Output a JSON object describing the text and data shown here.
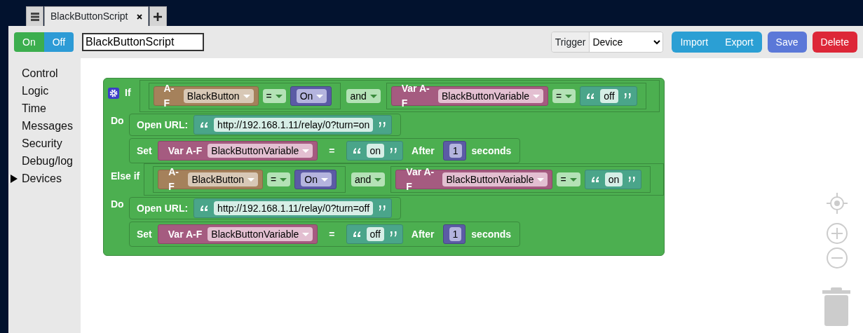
{
  "tabs": [
    {
      "label": "BlackButtonScript",
      "selected": true
    }
  ],
  "toolbar": {
    "toggle": [
      {
        "label": "On",
        "selected": true
      },
      {
        "label": "Off",
        "selected": false
      }
    ],
    "script_name": "BlackButtonScript",
    "trigger_label": "Trigger",
    "trigger_value": "Device",
    "buttons": [
      {
        "label": "Import",
        "kind": "info"
      },
      {
        "label": "Export",
        "kind": "info"
      },
      {
        "label": "Save",
        "kind": "primary"
      },
      {
        "label": "Delete",
        "kind": "danger"
      }
    ]
  },
  "sidebar": {
    "items": [
      {
        "label": "Control",
        "selected": false
      },
      {
        "label": "Logic",
        "selected": false
      },
      {
        "label": "Time",
        "selected": false
      },
      {
        "label": "Messages",
        "selected": false
      },
      {
        "label": "Security",
        "selected": false
      },
      {
        "label": "Debug/log",
        "selected": false
      },
      {
        "label": "Devices",
        "selected": true
      }
    ]
  },
  "program": {
    "branches": [
      {
        "keyword": "If",
        "condition": {
          "left": {
            "prefix": "A-F",
            "device": "BlackButton",
            "op": "=",
            "value": "On"
          },
          "join": "and",
          "right": {
            "prefix": "Var A-F",
            "variable": "BlackButtonVariable",
            "op": "=",
            "value": "off"
          }
        },
        "do_label": "Do",
        "statements": [
          {
            "kind": "url",
            "label": "Open URL:",
            "url": "http://192.168.1.11/relay/0?turn=on"
          },
          {
            "kind": "set",
            "label": "Set",
            "prefix": "Var A-F",
            "variable": "BlackButtonVariable",
            "eq": "=",
            "value": "on",
            "after_label": "After",
            "delay": "1",
            "unit": "seconds"
          }
        ]
      },
      {
        "keyword": "Else if",
        "condition": {
          "left": {
            "prefix": "A-F",
            "device": "BlackButton",
            "op": "=",
            "value": "On"
          },
          "join": "and",
          "right": {
            "prefix": "Var A-F",
            "variable": "BlackButtonVariable",
            "op": "=",
            "value": "on"
          }
        },
        "do_label": "Do",
        "statements": [
          {
            "kind": "url",
            "label": "Open URL:",
            "url": "http://192.168.1.11/relay/0?turn=off"
          },
          {
            "kind": "set",
            "label": "Set",
            "prefix": "Var A-F",
            "variable": "BlackButtonVariable",
            "eq": "=",
            "value": "off",
            "after_label": "After",
            "delay": "1",
            "unit": "seconds"
          }
        ]
      }
    ]
  }
}
